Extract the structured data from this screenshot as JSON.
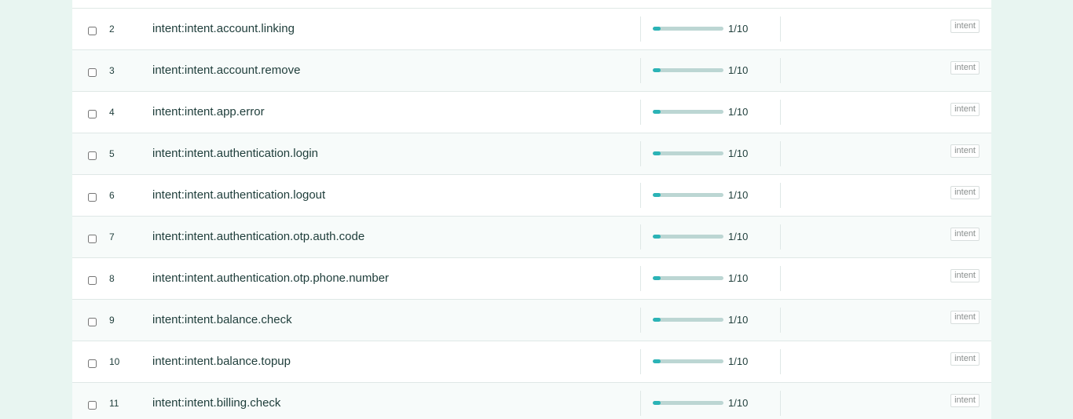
{
  "rows": [
    {
      "index": "2",
      "name": "intent:intent.account.linking",
      "progress_label": "1/10",
      "progress": 0.1,
      "tag": "intent"
    },
    {
      "index": "3",
      "name": "intent:intent.account.remove",
      "progress_label": "1/10",
      "progress": 0.1,
      "tag": "intent"
    },
    {
      "index": "4",
      "name": "intent:intent.app.error",
      "progress_label": "1/10",
      "progress": 0.1,
      "tag": "intent"
    },
    {
      "index": "5",
      "name": "intent:intent.authentication.login",
      "progress_label": "1/10",
      "progress": 0.1,
      "tag": "intent"
    },
    {
      "index": "6",
      "name": "intent:intent.authentication.logout",
      "progress_label": "1/10",
      "progress": 0.1,
      "tag": "intent"
    },
    {
      "index": "7",
      "name": "intent:intent.authentication.otp.auth.code",
      "progress_label": "1/10",
      "progress": 0.1,
      "tag": "intent"
    },
    {
      "index": "8",
      "name": "intent:intent.authentication.otp.phone.number",
      "progress_label": "1/10",
      "progress": 0.1,
      "tag": "intent"
    },
    {
      "index": "9",
      "name": "intent:intent.balance.check",
      "progress_label": "1/10",
      "progress": 0.1,
      "tag": "intent"
    },
    {
      "index": "10",
      "name": "intent:intent.balance.topup",
      "progress_label": "1/10",
      "progress": 0.1,
      "tag": "intent"
    },
    {
      "index": "11",
      "name": "intent:intent.billing.check",
      "progress_label": "1/10",
      "progress": 0.1,
      "tag": "intent"
    }
  ]
}
